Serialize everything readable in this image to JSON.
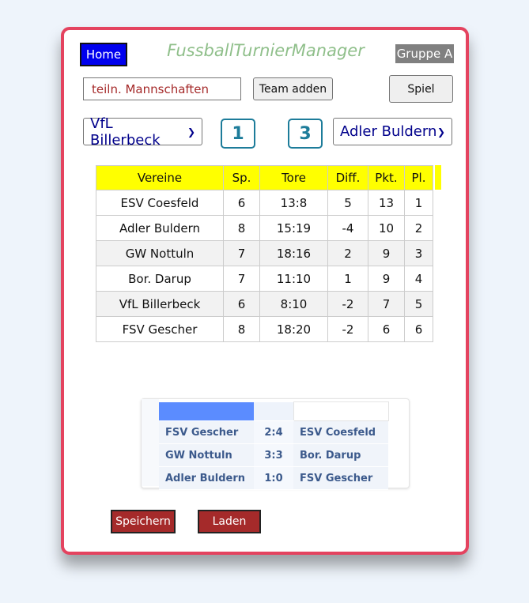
{
  "header": {
    "home_label": "Home",
    "app_title": "FussballTurnierManager",
    "group_label": "Gruppe A"
  },
  "controls": {
    "team_input_placeholder": "teiln. Mannschaften",
    "add_team_label": "Team adden",
    "game_label": "Spiel"
  },
  "match": {
    "home_team": "VfL Billerbeck",
    "home_score": "1",
    "away_score": "3",
    "away_team": "Adler Buldern"
  },
  "standings": {
    "headers": [
      "Vereine",
      "Sp.",
      "Tore",
      "Diff.",
      "Pkt.",
      "Pl."
    ],
    "rows": [
      [
        "ESV Coesfeld",
        "6",
        "13:8",
        "5",
        "13",
        "1"
      ],
      [
        "Adler Buldern",
        "8",
        "15:19",
        "-4",
        "10",
        "2"
      ],
      [
        "GW Nottuln",
        "7",
        "18:16",
        "2",
        "9",
        "3"
      ],
      [
        "Bor. Darup",
        "7",
        "11:10",
        "1",
        "9",
        "4"
      ],
      [
        "VfL Billerbeck",
        "6",
        "8:10",
        "-2",
        "7",
        "5"
      ],
      [
        "FSV Gescher",
        "8",
        "18:20",
        "-2",
        "6",
        "6"
      ]
    ]
  },
  "results": [
    [
      "FSV Gescher",
      "2:4",
      "ESV Coesfeld"
    ],
    [
      "GW Nottuln",
      "3:3",
      "Bor. Darup"
    ],
    [
      "Adler Buldern",
      "1:0",
      "FSV Gescher"
    ]
  ],
  "footer": {
    "save_label": "Speichern",
    "load_label": "Laden"
  },
  "colors": {
    "frame": "#e4435f",
    "home_button": "#0000ee",
    "title": "#8fbf8a",
    "table_header": "#ffff00",
    "action_button": "#a52a2a"
  },
  "icons": {
    "select_arrow": "chevron-down-icon"
  }
}
